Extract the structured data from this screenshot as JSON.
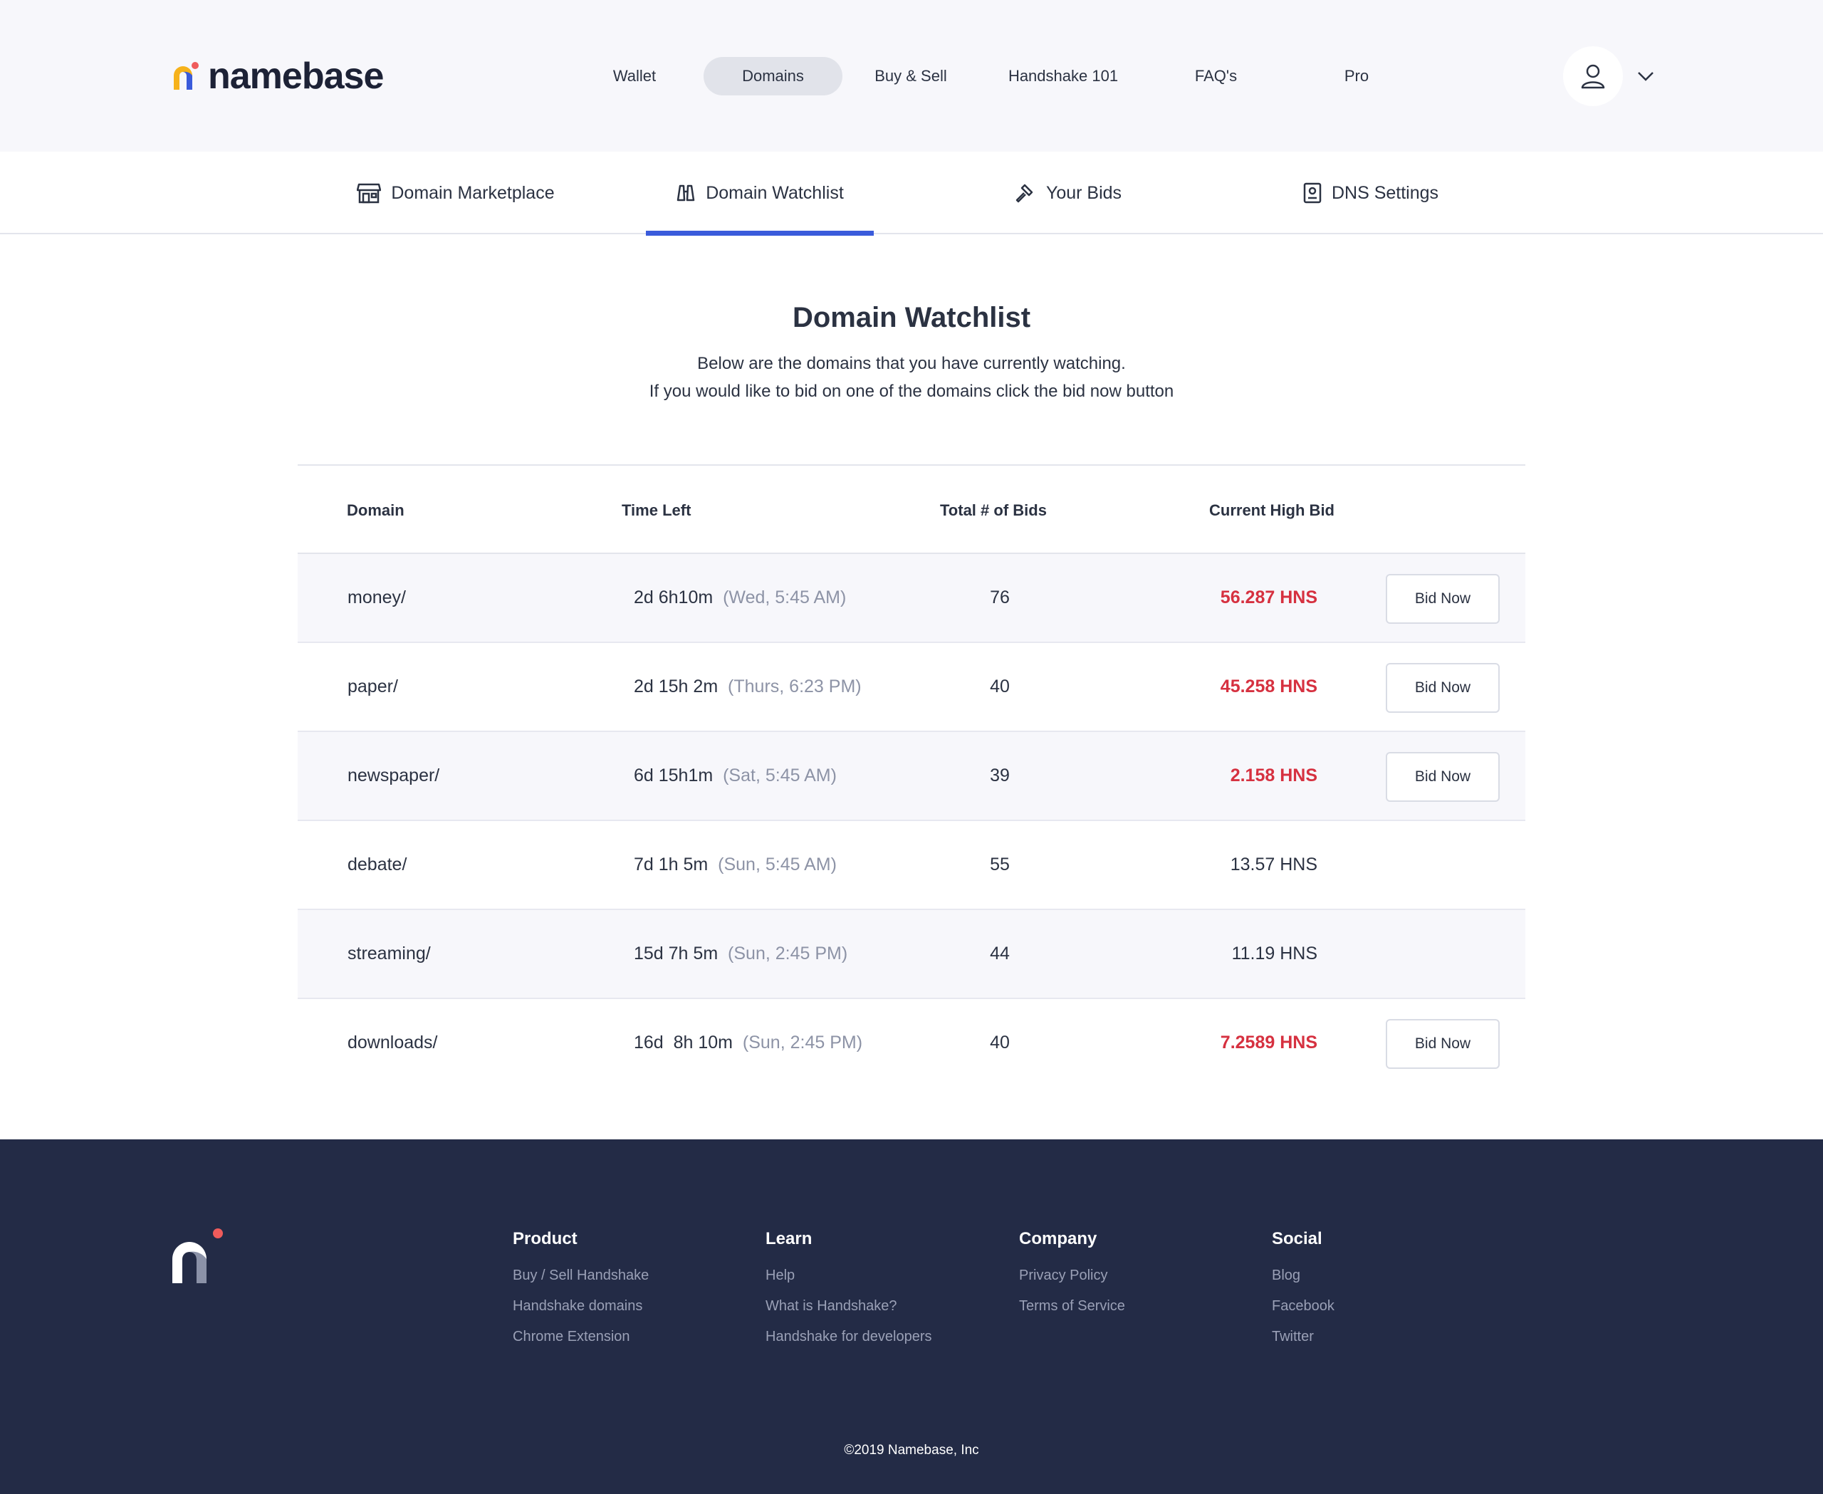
{
  "brand": {
    "name": "namebase",
    "accent": "#f6b21b",
    "dot": "#ef5b5b"
  },
  "nav": {
    "items": [
      {
        "label": "Wallet"
      },
      {
        "label": "Domains",
        "active": true
      },
      {
        "label": "Buy & Sell"
      },
      {
        "label": "Handshake 101"
      },
      {
        "label": "FAQ's"
      },
      {
        "label": "Pro"
      }
    ],
    "account_icon": "user-icon",
    "menu_icon": "chevron-down-icon"
  },
  "subtabs": [
    {
      "label": "Domain Marketplace",
      "icon": "storefront-icon"
    },
    {
      "label": "Domain Watchlist",
      "icon": "binoculars-icon",
      "active": true
    },
    {
      "label": "Your Bids",
      "icon": "gavel-icon"
    },
    {
      "label": "DNS Settings",
      "icon": "settings-document-icon"
    }
  ],
  "page": {
    "title": "Domain Watchlist",
    "subtitle_line1": "Below are the domains that you have currently watching.",
    "subtitle_line2": "If you would like to bid on one of the domains click the bid now button"
  },
  "table": {
    "headers": {
      "domain": "Domain",
      "time_left": "Time Left",
      "bids": "Total # of Bids",
      "high_bid": "Current High Bid"
    },
    "bid_label": "Bid Now",
    "rows": [
      {
        "domain": "money/",
        "time": "2d 6h10m",
        "when": "(Wed, 5:45 AM)",
        "bids": "76",
        "high_bid": "56.287 HNS",
        "highlight": true,
        "can_bid": true
      },
      {
        "domain": "paper/",
        "time": "2d 15h 2m",
        "when": "(Thurs, 6:23 PM)",
        "bids": "40",
        "high_bid": "45.258 HNS",
        "highlight": true,
        "can_bid": true
      },
      {
        "domain": "newspaper/",
        "time": "6d 15h1m",
        "when": "(Sat, 5:45 AM)",
        "bids": "39",
        "high_bid": "2.158 HNS",
        "highlight": true,
        "can_bid": true
      },
      {
        "domain": "debate/",
        "time": "7d 1h 5m",
        "when": "(Sun, 5:45 AM)",
        "bids": "55",
        "high_bid": "13.57 HNS",
        "highlight": false,
        "can_bid": false
      },
      {
        "domain": "streaming/",
        "time": "15d 7h 5m",
        "when": "(Sun, 2:45 PM)",
        "bids": "44",
        "high_bid": "11.19 HNS",
        "highlight": false,
        "can_bid": false
      },
      {
        "domain": "downloads/",
        "time": "16d  8h 10m",
        "when": "(Sun, 2:45 PM)",
        "bids": "40",
        "high_bid": "7.2589 HNS",
        "highlight": true,
        "can_bid": true
      }
    ]
  },
  "footer": {
    "columns": [
      {
        "heading": "Product",
        "links": [
          "Buy / Sell Handshake",
          "Handshake domains",
          "Chrome Extension"
        ]
      },
      {
        "heading": "Learn",
        "links": [
          "Help",
          "What is Handshake?",
          "Handshake for developers"
        ]
      },
      {
        "heading": "Company",
        "links": [
          "Privacy Policy",
          "Terms of Service"
        ]
      },
      {
        "heading": "Social",
        "links": [
          "Blog",
          "Facebook",
          "Twitter"
        ]
      }
    ],
    "copyright": "©2019 Namebase, Inc"
  }
}
